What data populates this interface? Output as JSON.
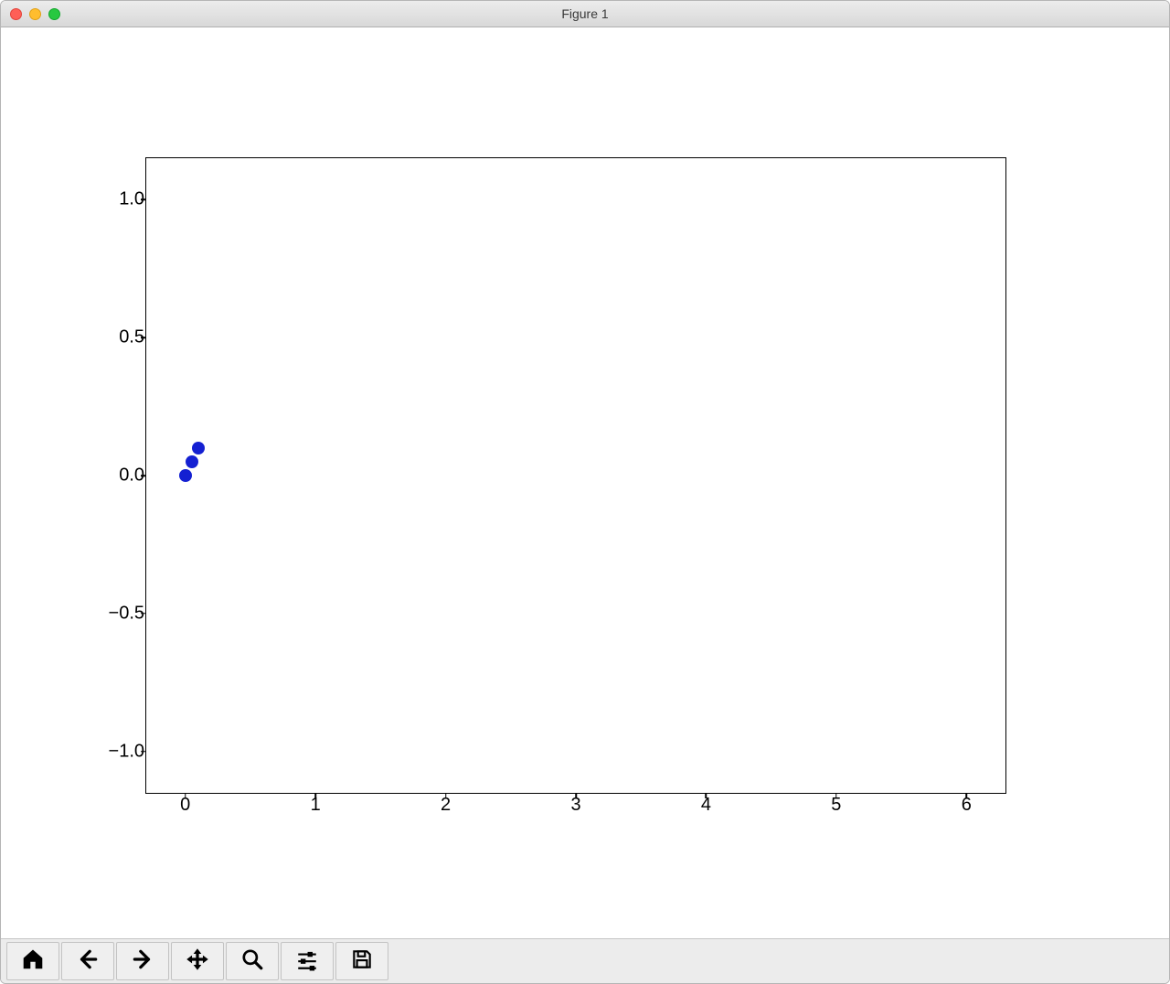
{
  "window": {
    "title": "Figure 1"
  },
  "traffic_lights": {
    "close": "#ff5f57",
    "minimize": "#ffbd2e",
    "zoom": "#28c840"
  },
  "toolbar": {
    "items": [
      {
        "name": "home-icon"
      },
      {
        "name": "back-icon"
      },
      {
        "name": "forward-icon"
      },
      {
        "name": "pan-icon"
      },
      {
        "name": "zoom-icon"
      },
      {
        "name": "configure-icon"
      },
      {
        "name": "save-icon"
      }
    ]
  },
  "chart_data": {
    "type": "scatter",
    "title": "",
    "xlabel": "",
    "ylabel": "",
    "xlim": [
      -0.3,
      6.3
    ],
    "ylim": [
      -1.15,
      1.15
    ],
    "xticks": [
      0,
      1,
      2,
      3,
      4,
      5,
      6
    ],
    "yticks": [
      -1.0,
      -0.5,
      0.0,
      0.5,
      1.0
    ],
    "x": [
      0.0,
      0.05,
      0.1
    ],
    "y": [
      0.0,
      0.05,
      0.1
    ],
    "color": "#1420d2"
  }
}
